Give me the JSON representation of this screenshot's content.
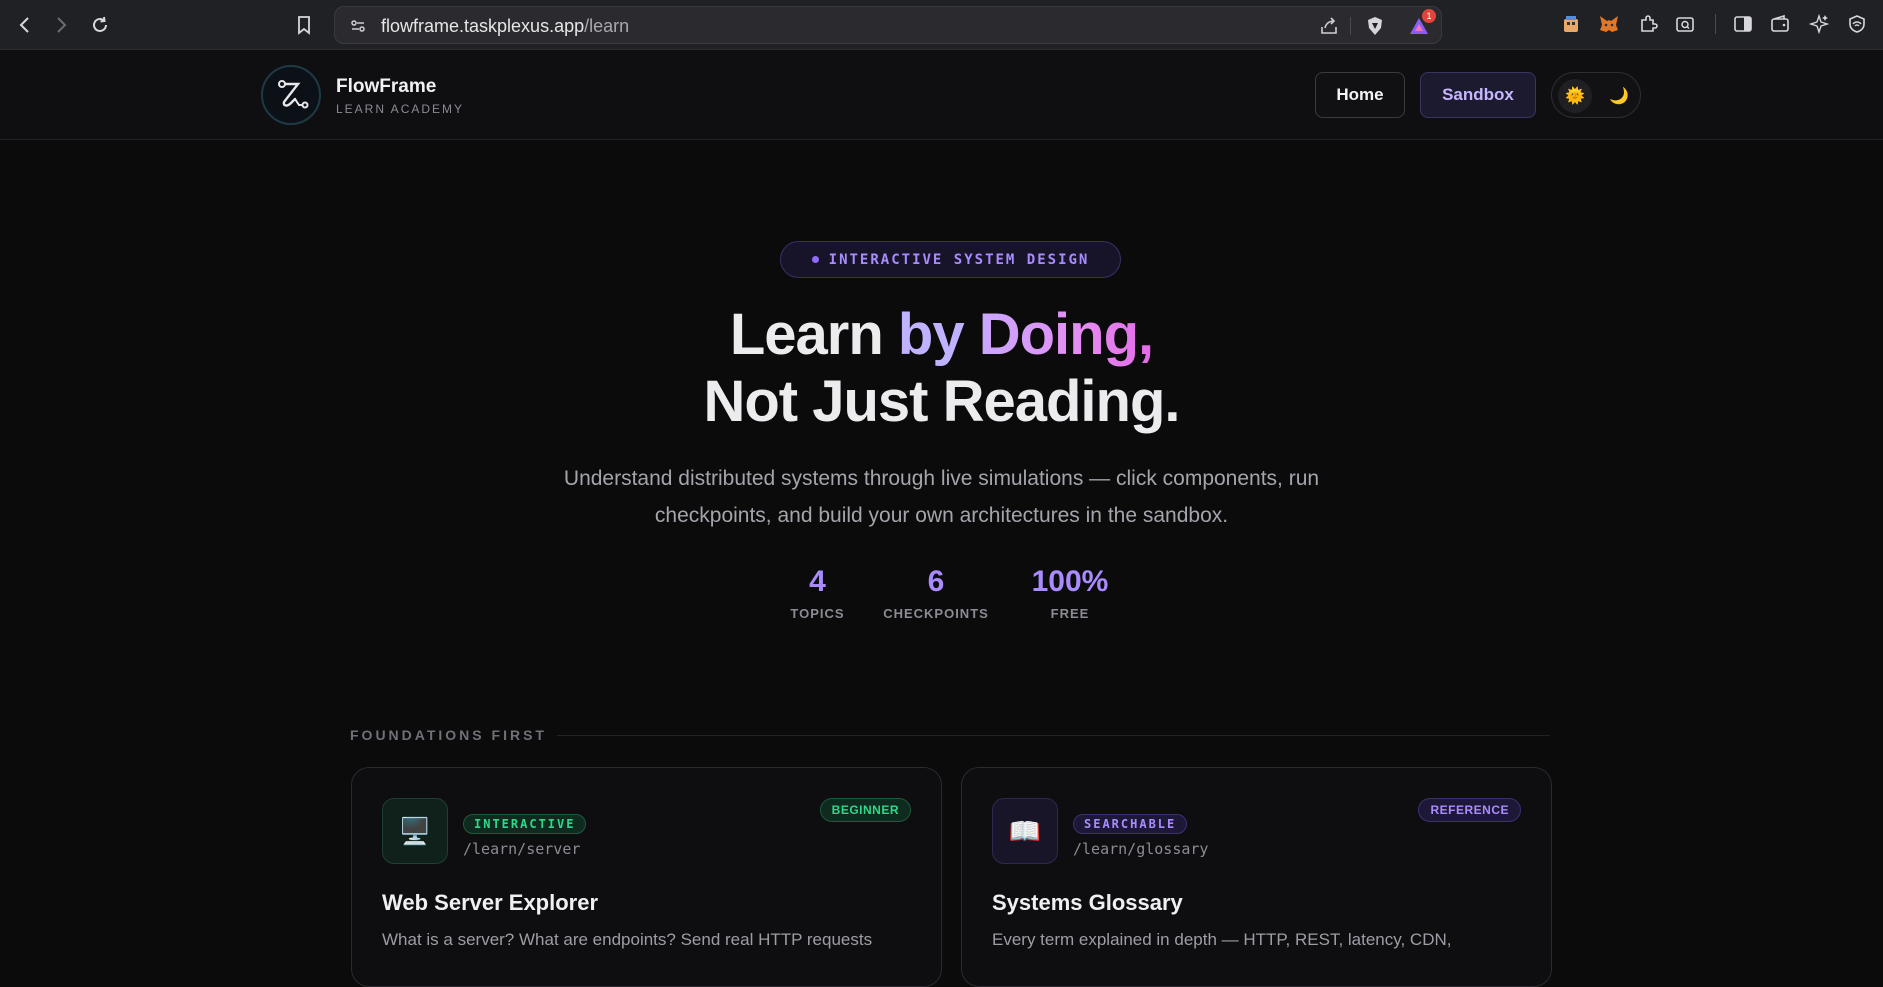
{
  "browser": {
    "url_host": "flowframe.taskplexus.app",
    "url_path": "/learn",
    "brave_badge_count": "1",
    "icons": [
      "back-icon",
      "forward-icon",
      "reload-icon",
      "bookmark-icon",
      "site-settings-icon",
      "share-icon",
      "brave-shield-icon",
      "brave-rewards-icon",
      "extension-icon",
      "metamask-icon",
      "puzzle-icon",
      "search-tab-icon",
      "sidebar-icon",
      "wallet-icon",
      "leo-ai-icon",
      "vpn-icon"
    ]
  },
  "header": {
    "brand_name": "FlowFrame",
    "brand_sub": "LEARN ACADEMY",
    "home_label": "Home",
    "sandbox_label": "Sandbox",
    "theme_light_icon": "🌞",
    "theme_dark_icon": "🌙"
  },
  "hero": {
    "pill": "INTERACTIVE SYSTEM DESIGN",
    "title_learn": "Learn",
    "title_by": "by",
    "title_doing": "Doing,",
    "title_line2": "Not Just Reading.",
    "lead_line1": "Understand distributed systems through live simulations — click components, run",
    "lead_line2": "checkpoints, and build your own architectures in the sandbox.",
    "stats": [
      {
        "value": "4",
        "label": "TOPICS"
      },
      {
        "value": "6",
        "label": "CHECKPOINTS"
      },
      {
        "value": "100%",
        "label": "FREE"
      }
    ]
  },
  "section": {
    "title": "FOUNDATIONS FIRST",
    "cards": [
      {
        "icon": "🖥️",
        "tag": "INTERACTIVE",
        "route": "/learn/server",
        "level": "BEGINNER",
        "title": "Web Server Explorer",
        "desc": "What is a server? What are endpoints? Send real HTTP requests"
      },
      {
        "icon": "📖",
        "tag": "SEARCHABLE",
        "route": "/learn/glossary",
        "level": "REFERENCE",
        "title": "Systems Glossary",
        "desc": "Every term explained in depth — HTTP, REST, latency, CDN,"
      }
    ]
  },
  "colors": {
    "accent": "#a98bff",
    "green_tag": "#2fd98a",
    "background": "#0b0b0c"
  }
}
